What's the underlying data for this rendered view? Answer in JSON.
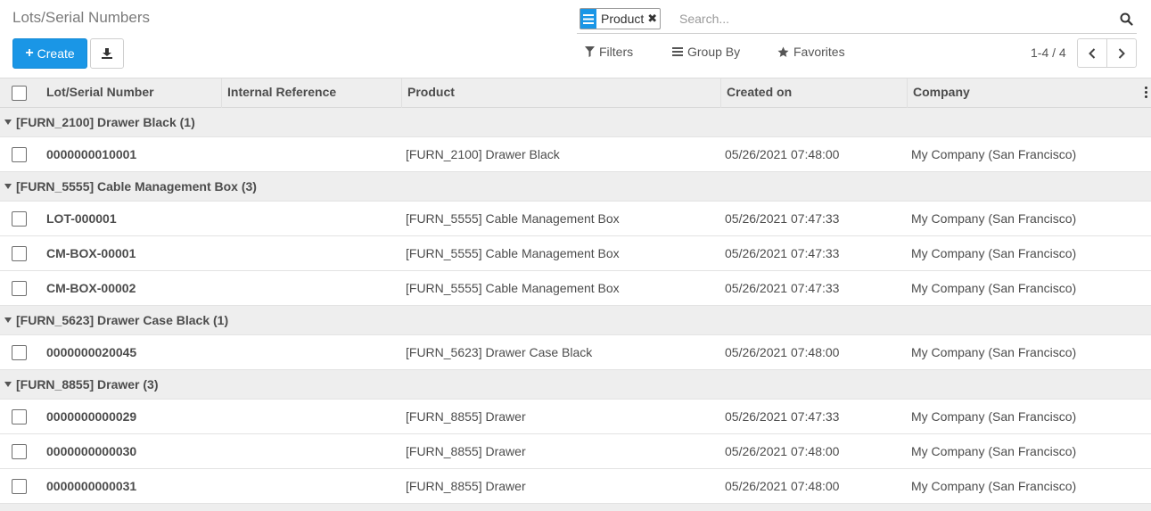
{
  "header": {
    "title": "Lots/Serial Numbers",
    "create_label": "Create"
  },
  "search": {
    "facet_label": "Product",
    "placeholder": "Search..."
  },
  "toolbar": {
    "filters_label": "Filters",
    "groupby_label": "Group By",
    "favorites_label": "Favorites",
    "pager": "1-4 / 4"
  },
  "columns": [
    "Lot/Serial Number",
    "Internal Reference",
    "Product",
    "Created on",
    "Company"
  ],
  "groups": [
    {
      "label": "[FURN_2100] Drawer Black (1)",
      "rows": [
        {
          "lot": "0000000010001",
          "ref": "",
          "product": "[FURN_2100] Drawer Black",
          "created": "05/26/2021 07:48:00",
          "company": "My Company (San Francisco)"
        }
      ]
    },
    {
      "label": "[FURN_5555] Cable Management Box (3)",
      "rows": [
        {
          "lot": "LOT-000001",
          "ref": "",
          "product": "[FURN_5555] Cable Management Box",
          "created": "05/26/2021 07:47:33",
          "company": "My Company (San Francisco)"
        },
        {
          "lot": "CM-BOX-00001",
          "ref": "",
          "product": "[FURN_5555] Cable Management Box",
          "created": "05/26/2021 07:47:33",
          "company": "My Company (San Francisco)"
        },
        {
          "lot": "CM-BOX-00002",
          "ref": "",
          "product": "[FURN_5555] Cable Management Box",
          "created": "05/26/2021 07:47:33",
          "company": "My Company (San Francisco)"
        }
      ]
    },
    {
      "label": "[FURN_5623] Drawer Case Black (1)",
      "rows": [
        {
          "lot": "0000000020045",
          "ref": "",
          "product": "[FURN_5623] Drawer Case Black",
          "created": "05/26/2021 07:48:00",
          "company": "My Company (San Francisco)"
        }
      ]
    },
    {
      "label": "[FURN_8855] Drawer (3)",
      "rows": [
        {
          "lot": "0000000000029",
          "ref": "",
          "product": "[FURN_8855] Drawer",
          "created": "05/26/2021 07:47:33",
          "company": "My Company (San Francisco)"
        },
        {
          "lot": "0000000000030",
          "ref": "",
          "product": "[FURN_8855] Drawer",
          "created": "05/26/2021 07:48:00",
          "company": "My Company (San Francisco)"
        },
        {
          "lot": "0000000000031",
          "ref": "",
          "product": "[FURN_8855] Drawer",
          "created": "05/26/2021 07:48:00",
          "company": "My Company (San Francisco)"
        }
      ]
    }
  ],
  "colors": {
    "primary": "#1a96e6",
    "header_bg": "#eeeeee"
  }
}
